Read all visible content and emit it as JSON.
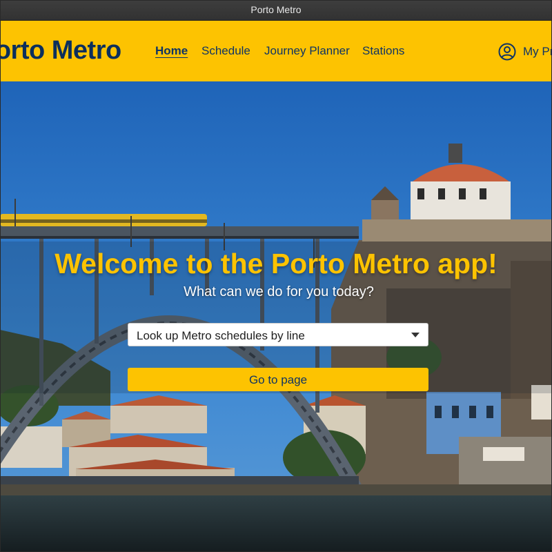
{
  "window": {
    "title": "Porto Metro"
  },
  "nav": {
    "brand": "Porto Metro",
    "links": [
      {
        "label": "Home",
        "active": true
      },
      {
        "label": "Schedule",
        "active": false
      },
      {
        "label": "Journey Planner",
        "active": false
      },
      {
        "label": "Stations",
        "active": false
      }
    ],
    "profile_label": "My Profile",
    "profile_icon": "user-circle-icon"
  },
  "hero": {
    "heading": "Welcome to the Porto Metro app!",
    "subheading": "What can we do for you today?",
    "select_value": "Look up Metro schedules by line",
    "button_label": "Go to page"
  },
  "colors": {
    "brand_yellow": "#fdc301",
    "brand_navy": "#0f3464",
    "sky": "#2a6fc0",
    "river": "#2b3a40"
  }
}
